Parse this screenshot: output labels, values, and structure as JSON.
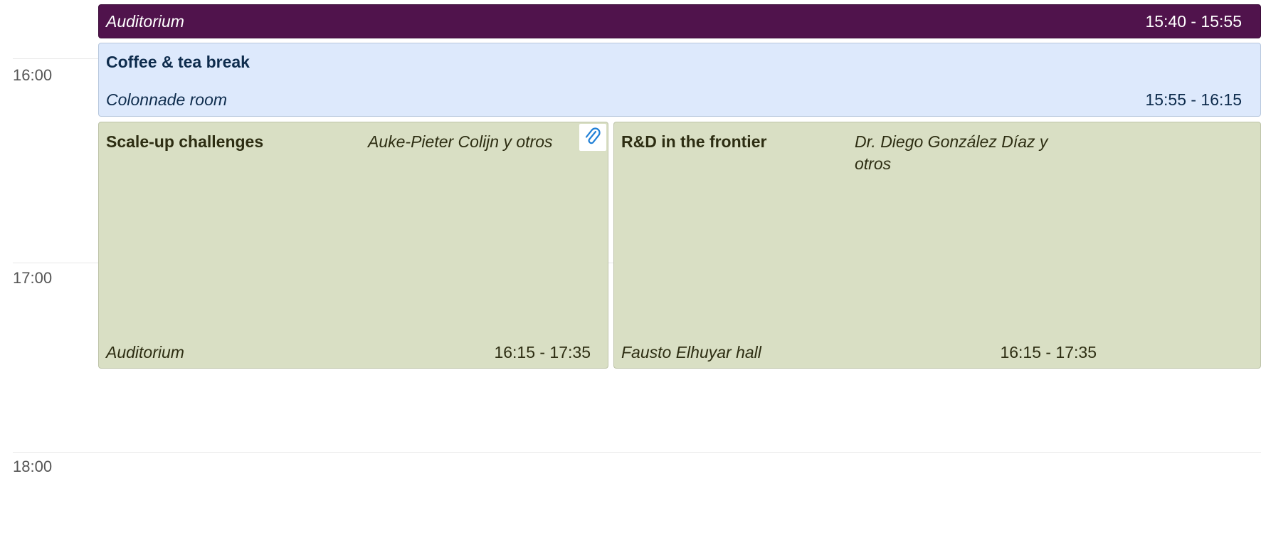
{
  "time_axis": {
    "labels": [
      "16:00",
      "17:00",
      "18:00"
    ]
  },
  "events": {
    "auditorium_bar": {
      "location": "Auditorium",
      "time": "15:40 - 15:55",
      "color": "#50134c"
    },
    "coffee_break": {
      "title": "Coffee & tea break",
      "location": "Colonnade room",
      "time": "15:55 - 16:15",
      "color": "#dde9fc"
    },
    "scale_up": {
      "title": "Scale-up challenges",
      "speakers": "Auke-Pieter Colijn y otros",
      "location": "Auditorium",
      "time": "16:15 - 17:35",
      "attachment_icon": "paperclip-icon",
      "color": "#d9dfc4"
    },
    "rnd_frontier": {
      "title": "R&D in the frontier",
      "speakers_line1": "Dr. Diego González Díaz y",
      "speakers_line2": "otros",
      "location": "Fausto Elhuyar hall",
      "time": "16:15 - 17:35",
      "color": "#d9dfc4"
    }
  }
}
